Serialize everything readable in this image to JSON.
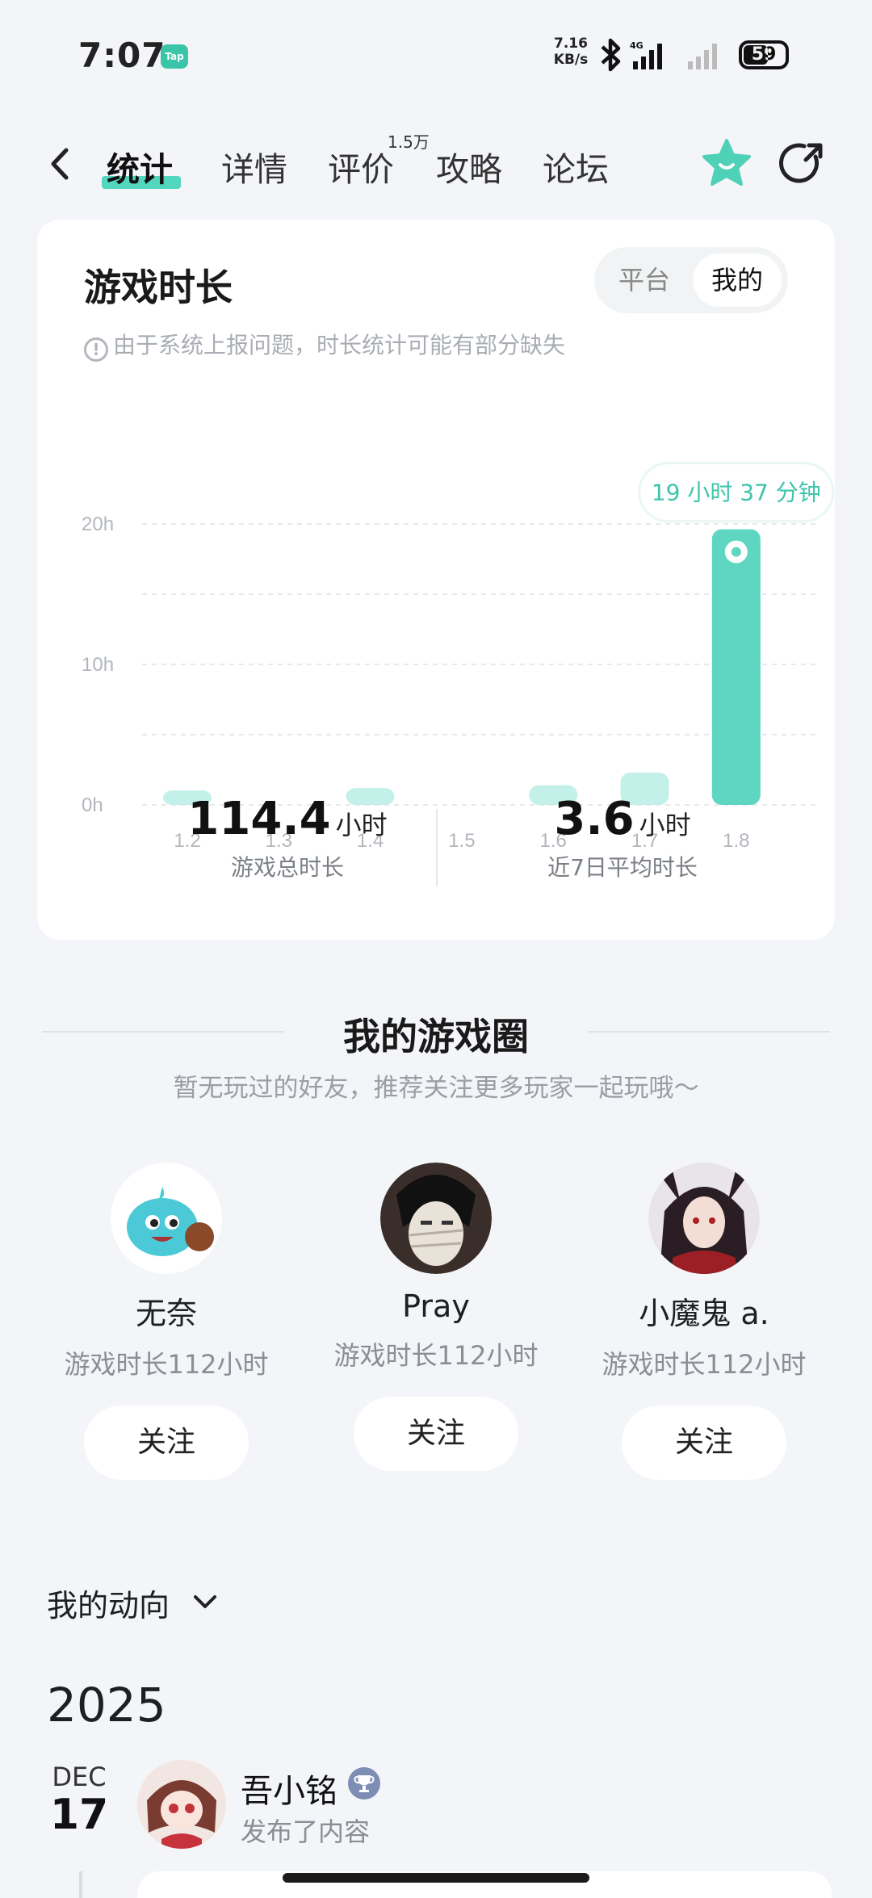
{
  "status_bar": {
    "time": "7:07",
    "tap_badge": "Tap",
    "speed_value": "7.16",
    "speed_unit": "KB/s",
    "network": "4G",
    "battery": "59"
  },
  "nav": {
    "tabs": [
      {
        "label": "统计",
        "active": true
      },
      {
        "label": "详情",
        "active": false
      },
      {
        "label": "评价",
        "active": false,
        "badge": "1.5万"
      },
      {
        "label": "攻略",
        "active": false
      },
      {
        "label": "论坛",
        "active": false
      }
    ],
    "icons": [
      "back-icon",
      "star-icon",
      "share-icon"
    ]
  },
  "playtime_card": {
    "title": "游戏时长",
    "segment": {
      "platform": "平台",
      "mine": "我的",
      "selected": "我的"
    },
    "notice": "由于系统上报问题，时长统计可能有部分缺失",
    "tooltip": "19 小时 37 分钟",
    "summary": {
      "total_value": "114.4",
      "total_unit": "小时",
      "total_label": "游戏总时长",
      "avg_value": "3.6",
      "avg_unit": "小时",
      "avg_label": "近7日平均时长"
    }
  },
  "chart_data": {
    "type": "bar",
    "categories": [
      "1.2",
      "1.3",
      "1.4",
      "1.5",
      "1.6",
      "1.7",
      "1.8"
    ],
    "values": [
      0.5,
      0,
      1.2,
      0,
      1.4,
      2.3,
      19.62
    ],
    "yticks": [
      "0h",
      "10h",
      "20h"
    ],
    "ylim": [
      0,
      20
    ],
    "highlight_index": 6,
    "grid": true,
    "colors": {
      "highlight": "#5fd6c1",
      "normal": "#c3f0e8"
    }
  },
  "game_circle": {
    "title": "我的游戏圈",
    "subtitle": "暂无玩过的好友，推荐关注更多玩家一起玩哦～",
    "friends": [
      {
        "name": "无奈",
        "sub": "游戏时长112小时",
        "button": "关注"
      },
      {
        "name": "Pray",
        "sub": "游戏时长112小时",
        "button": "关注"
      },
      {
        "name": "小魔鬼 a.",
        "sub": "游戏时长112小时",
        "button": "关注"
      }
    ]
  },
  "activity": {
    "title": "我的动向",
    "year": "2025",
    "date_month": "DEC",
    "date_day": "17",
    "post_user": "吾小铭",
    "post_action": "发布了内容"
  }
}
